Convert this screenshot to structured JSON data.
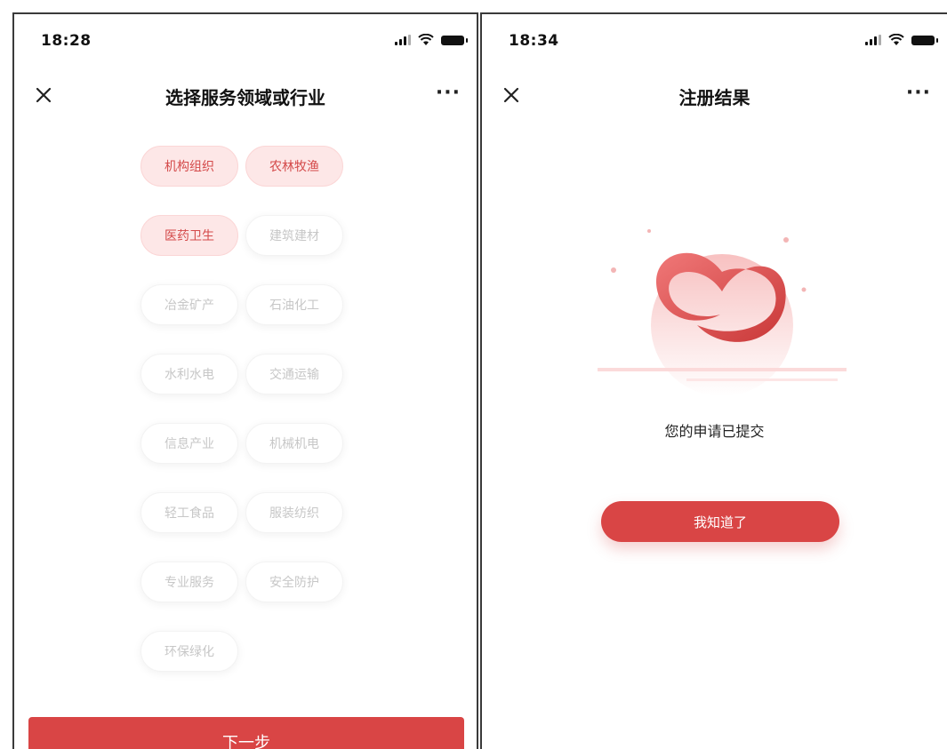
{
  "left": {
    "status_time": "18:28",
    "title": "选择服务领域或行业",
    "more_label": "···",
    "tags": [
      {
        "label": "机构组织",
        "selected": true
      },
      {
        "label": "农林牧渔",
        "selected": true
      },
      {
        "label": "医药卫生",
        "selected": true
      },
      {
        "label": "建筑建材",
        "selected": false
      },
      {
        "label": "冶金矿产",
        "selected": false
      },
      {
        "label": "石油化工",
        "selected": false
      },
      {
        "label": "水利水电",
        "selected": false
      },
      {
        "label": "交通运输",
        "selected": false
      },
      {
        "label": "信息产业",
        "selected": false
      },
      {
        "label": "机械机电",
        "selected": false
      },
      {
        "label": "轻工食品",
        "selected": false
      },
      {
        "label": "服装纺织",
        "selected": false
      },
      {
        "label": "专业服务",
        "selected": false
      },
      {
        "label": "安全防护",
        "selected": false
      },
      {
        "label": "环保绿化",
        "selected": false
      }
    ],
    "next_label": "下一步"
  },
  "right": {
    "status_time": "18:34",
    "title": "注册结果",
    "more_label": "···",
    "result_text": "您的申请已提交",
    "ok_label": "我知道了"
  },
  "colors": {
    "accent": "#d94545",
    "tag_selected_bg": "#fde7e7",
    "tag_selected_text": "#d44a4a",
    "tag_unselected_text": "#c7c7c7"
  },
  "icons": {
    "close": "close-icon",
    "more": "more-icon",
    "signal": "signal-icon",
    "wifi": "wifi-icon",
    "battery": "battery-icon",
    "heart": "heart-icon"
  }
}
